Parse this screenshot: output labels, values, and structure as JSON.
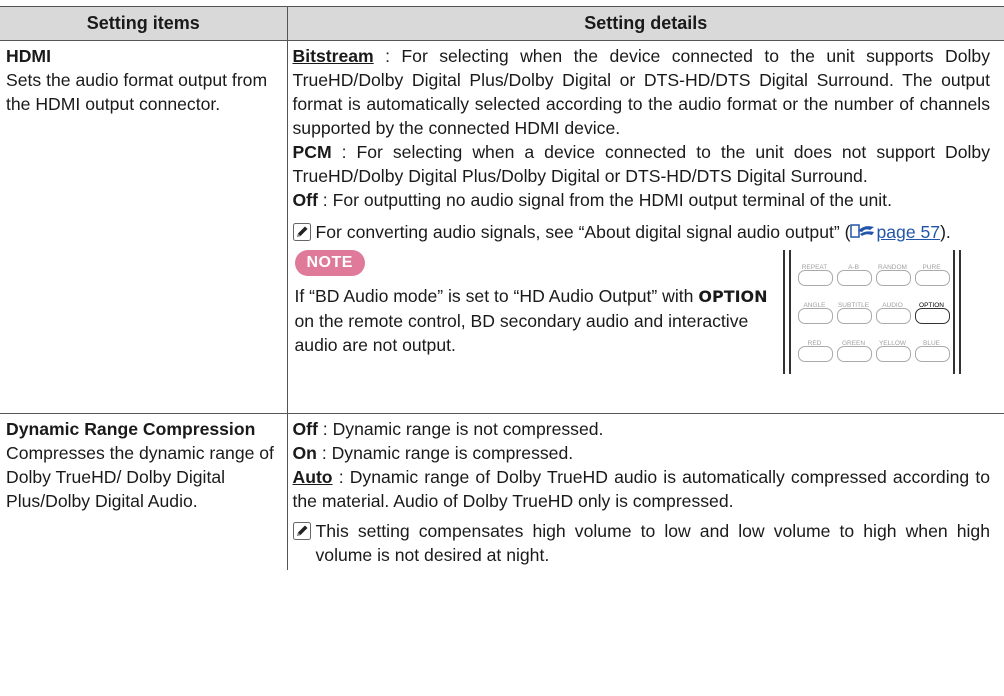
{
  "table": {
    "headers": [
      "Setting items",
      "Setting details"
    ]
  },
  "hdmi": {
    "title": "HDMI",
    "description": "Sets the audio format output from the HDMI output connector.",
    "options": [
      {
        "name": "Bitstream",
        "text": " : For selecting when the device connected to the unit supports Dolby TrueHD/Dolby Digital Plus/Dolby Digital or DTS-HD/DTS Digital Surround. The output format is automatically selected according to the audio format or the number of channels supported by the connected HDMI device."
      },
      {
        "name": "PCM",
        "text": " : For selecting when a device connected to the unit does not support Dolby TrueHD/Dolby Digital Plus/Dolby Digital or DTS-HD/DTS Digital Surround."
      },
      {
        "name": "Off",
        "text": " : For outputting no audio signal from the HDMI output terminal of the unit."
      }
    ],
    "memo_text": "For converting audio signals, see “About digital signal audio output” (",
    "memo_link": "page 57",
    "memo_end": ").",
    "note_label": "NOTE",
    "note_part1": "If “BD Audio mode” is set to “HD Audio Output” with ",
    "note_keyword": "OPTION",
    "note_part2": " on the remote control, BD secondary audio and interactive audio are not output."
  },
  "remote": {
    "labels": [
      "REPEAT",
      "A-B",
      "RANDOM",
      "PURE",
      "ANGLE",
      "SUBTITLE",
      "AUDIO",
      "OPTION",
      "RED",
      "GREEN",
      "YELLOW",
      "BLUE"
    ],
    "active": "OPTION"
  },
  "drc": {
    "title": "Dynamic Range Compression",
    "description": "Compresses the dynamic range of Dolby TrueHD/ Dolby Digital Plus/Dolby Digital Audio.",
    "options": [
      {
        "name": "Off",
        "text": " : Dynamic range is not compressed."
      },
      {
        "name": "On",
        "text": " : Dynamic range is compressed."
      },
      {
        "name": "Auto",
        "text": " : Dynamic range of Dolby TrueHD audio is automatically compressed according to the material. Audio of Dolby TrueHD only is compressed."
      }
    ],
    "memo_text": "This setting compensates high volume to low and low volume to high when high volume is not desired at night."
  }
}
